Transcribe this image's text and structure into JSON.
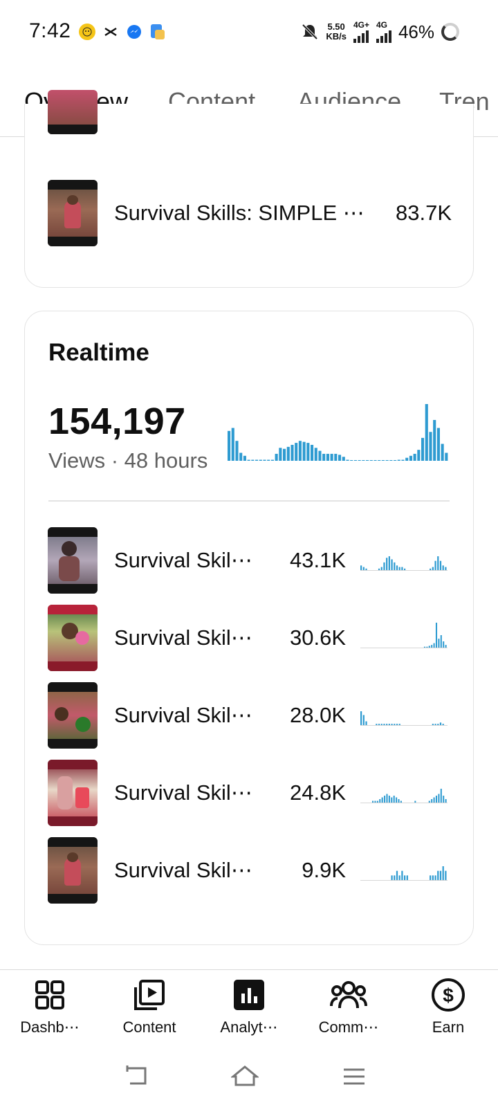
{
  "status_bar": {
    "time": "7:42",
    "speed_value": "5.50",
    "speed_unit": "KB/s",
    "net1": "4G+",
    "net2": "4G",
    "battery": "46%"
  },
  "tabs": [
    {
      "label": "Overview",
      "active": true
    },
    {
      "label": "Content",
      "active": false
    },
    {
      "label": "Audience",
      "active": false
    },
    {
      "label": "Tren",
      "active": false
    }
  ],
  "top_card": {
    "item": {
      "title": "Survival Skills: SIMPLE ⋯",
      "value": "83.7K"
    }
  },
  "realtime": {
    "title": "Realtime",
    "total": "154,197",
    "subtitle": "Views · 48 hours",
    "chart_data": {
      "type": "bar",
      "color": "#2e9bd1",
      "values": [
        30,
        33,
        20,
        8,
        5,
        1,
        1,
        1,
        1,
        1,
        1,
        1,
        7,
        13,
        12,
        14,
        16,
        18,
        20,
        19,
        18,
        16,
        13,
        10,
        7,
        7,
        7,
        7,
        6,
        4,
        1,
        0,
        0,
        0,
        0,
        0,
        0,
        0,
        0,
        0,
        0,
        0,
        0,
        1,
        1,
        3,
        5,
        7,
        11,
        23,
        57,
        29,
        41,
        33,
        17,
        8
      ]
    },
    "videos": [
      {
        "title": "Survival Skil⋯",
        "value": "43.1K",
        "spark": [
          3,
          2,
          1,
          0,
          0,
          0,
          0,
          1,
          2,
          5,
          8,
          9,
          7,
          5,
          3,
          2,
          2,
          1,
          0,
          0,
          0,
          0,
          0,
          0,
          0,
          0,
          0,
          1,
          2,
          6,
          9,
          6,
          3,
          2
        ]
      },
      {
        "title": "Survival Skil⋯",
        "value": "30.6K",
        "spark": [
          0,
          0,
          0,
          0,
          0,
          0,
          0,
          0,
          0,
          0,
          0,
          0,
          0,
          0,
          0,
          0,
          0,
          0,
          0,
          0,
          0,
          0,
          0,
          0,
          0,
          0,
          0,
          1,
          1,
          2,
          3,
          5,
          28,
          10,
          14,
          7,
          3
        ]
      },
      {
        "title": "Survival Skil⋯",
        "value": "28.0K",
        "spark": [
          11,
          8,
          3,
          0,
          0,
          0,
          1,
          1,
          1,
          1,
          1,
          1,
          1,
          1,
          1,
          1,
          0,
          0,
          0,
          0,
          0,
          0,
          0,
          0,
          0,
          0,
          0,
          0,
          1,
          1,
          1,
          2,
          1,
          0
        ]
      },
      {
        "title": "Survival Skil⋯",
        "value": "24.8K",
        "spark": [
          0,
          0,
          0,
          0,
          0,
          1,
          1,
          1,
          2,
          3,
          4,
          5,
          4,
          3,
          4,
          3,
          2,
          1,
          0,
          0,
          0,
          0,
          0,
          1,
          0,
          0,
          0,
          0,
          0,
          1,
          2,
          3,
          4,
          5,
          8,
          4,
          2
        ]
      },
      {
        "title": "Survival Skil⋯",
        "value": "9.9K",
        "spark": [
          0,
          0,
          0,
          0,
          0,
          0,
          0,
          0,
          0,
          0,
          0,
          0,
          1,
          1,
          2,
          1,
          2,
          1,
          1,
          0,
          0,
          0,
          0,
          0,
          0,
          0,
          0,
          1,
          1,
          1,
          2,
          2,
          3,
          2
        ]
      }
    ]
  },
  "bottom_nav": [
    {
      "label": "Dashb⋯",
      "icon": "dashboard-icon"
    },
    {
      "label": "Content",
      "icon": "content-icon"
    },
    {
      "label": "Analyt⋯",
      "icon": "analytics-icon"
    },
    {
      "label": "Comm⋯",
      "icon": "community-icon"
    },
    {
      "label": "Earn",
      "icon": "earn-icon"
    }
  ],
  "colors": {
    "accent_bars": "#2e9bd1",
    "text_primary": "#0f0f0f",
    "text_secondary": "#606060"
  }
}
